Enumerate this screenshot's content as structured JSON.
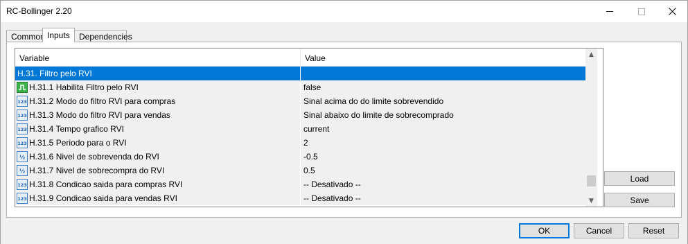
{
  "window": {
    "title": "RC-Bollinger 2.20"
  },
  "tabs": [
    {
      "label": "Common"
    },
    {
      "label": "Inputs"
    },
    {
      "label": "Dependencies"
    }
  ],
  "table": {
    "columns": [
      "Variable",
      "Value"
    ],
    "rows": [
      {
        "variable": "H.31. Filtro pelo RVI",
        "value": "",
        "icon": "none",
        "selected": true
      },
      {
        "variable": "H.31.1 Habilita Filtro pelo RVI",
        "value": "false",
        "icon": "bool-icon"
      },
      {
        "variable": "H.31.2 Modo do filtro RVI para compras",
        "value": "Sinal acima do do limite sobrevendido",
        "icon": "int-icon"
      },
      {
        "variable": "H.31.3 Modo do filtro RVI para vendas",
        "value": "Sinal abaixo do limite de sobrecomprado",
        "icon": "int-icon"
      },
      {
        "variable": "H.31.4 Tempo grafico RVI",
        "value": "current",
        "icon": "int-icon"
      },
      {
        "variable": "H.31.5 Periodo para o RVI",
        "value": "2",
        "icon": "int-icon"
      },
      {
        "variable": "H.31.6 Nivel de sobrevenda do RVI",
        "value": "-0.5",
        "icon": "double-icon"
      },
      {
        "variable": "H.31.7 Nivel de sobrecompra do RVI",
        "value": "0.5",
        "icon": "double-icon"
      },
      {
        "variable": "H.31.8 Condicao saida para compras RVI",
        "value": "-- Desativado --",
        "icon": "int-icon"
      },
      {
        "variable": "H.31.9 Condicao saida para vendas RVI",
        "value": "-- Desativado --",
        "icon": "int-icon"
      }
    ]
  },
  "scrollbar": {
    "position": 0.93
  },
  "side_buttons": {
    "load": "Load",
    "save": "Save"
  },
  "footer_buttons": {
    "ok": "OK",
    "cancel": "Cancel",
    "reset": "Reset"
  }
}
